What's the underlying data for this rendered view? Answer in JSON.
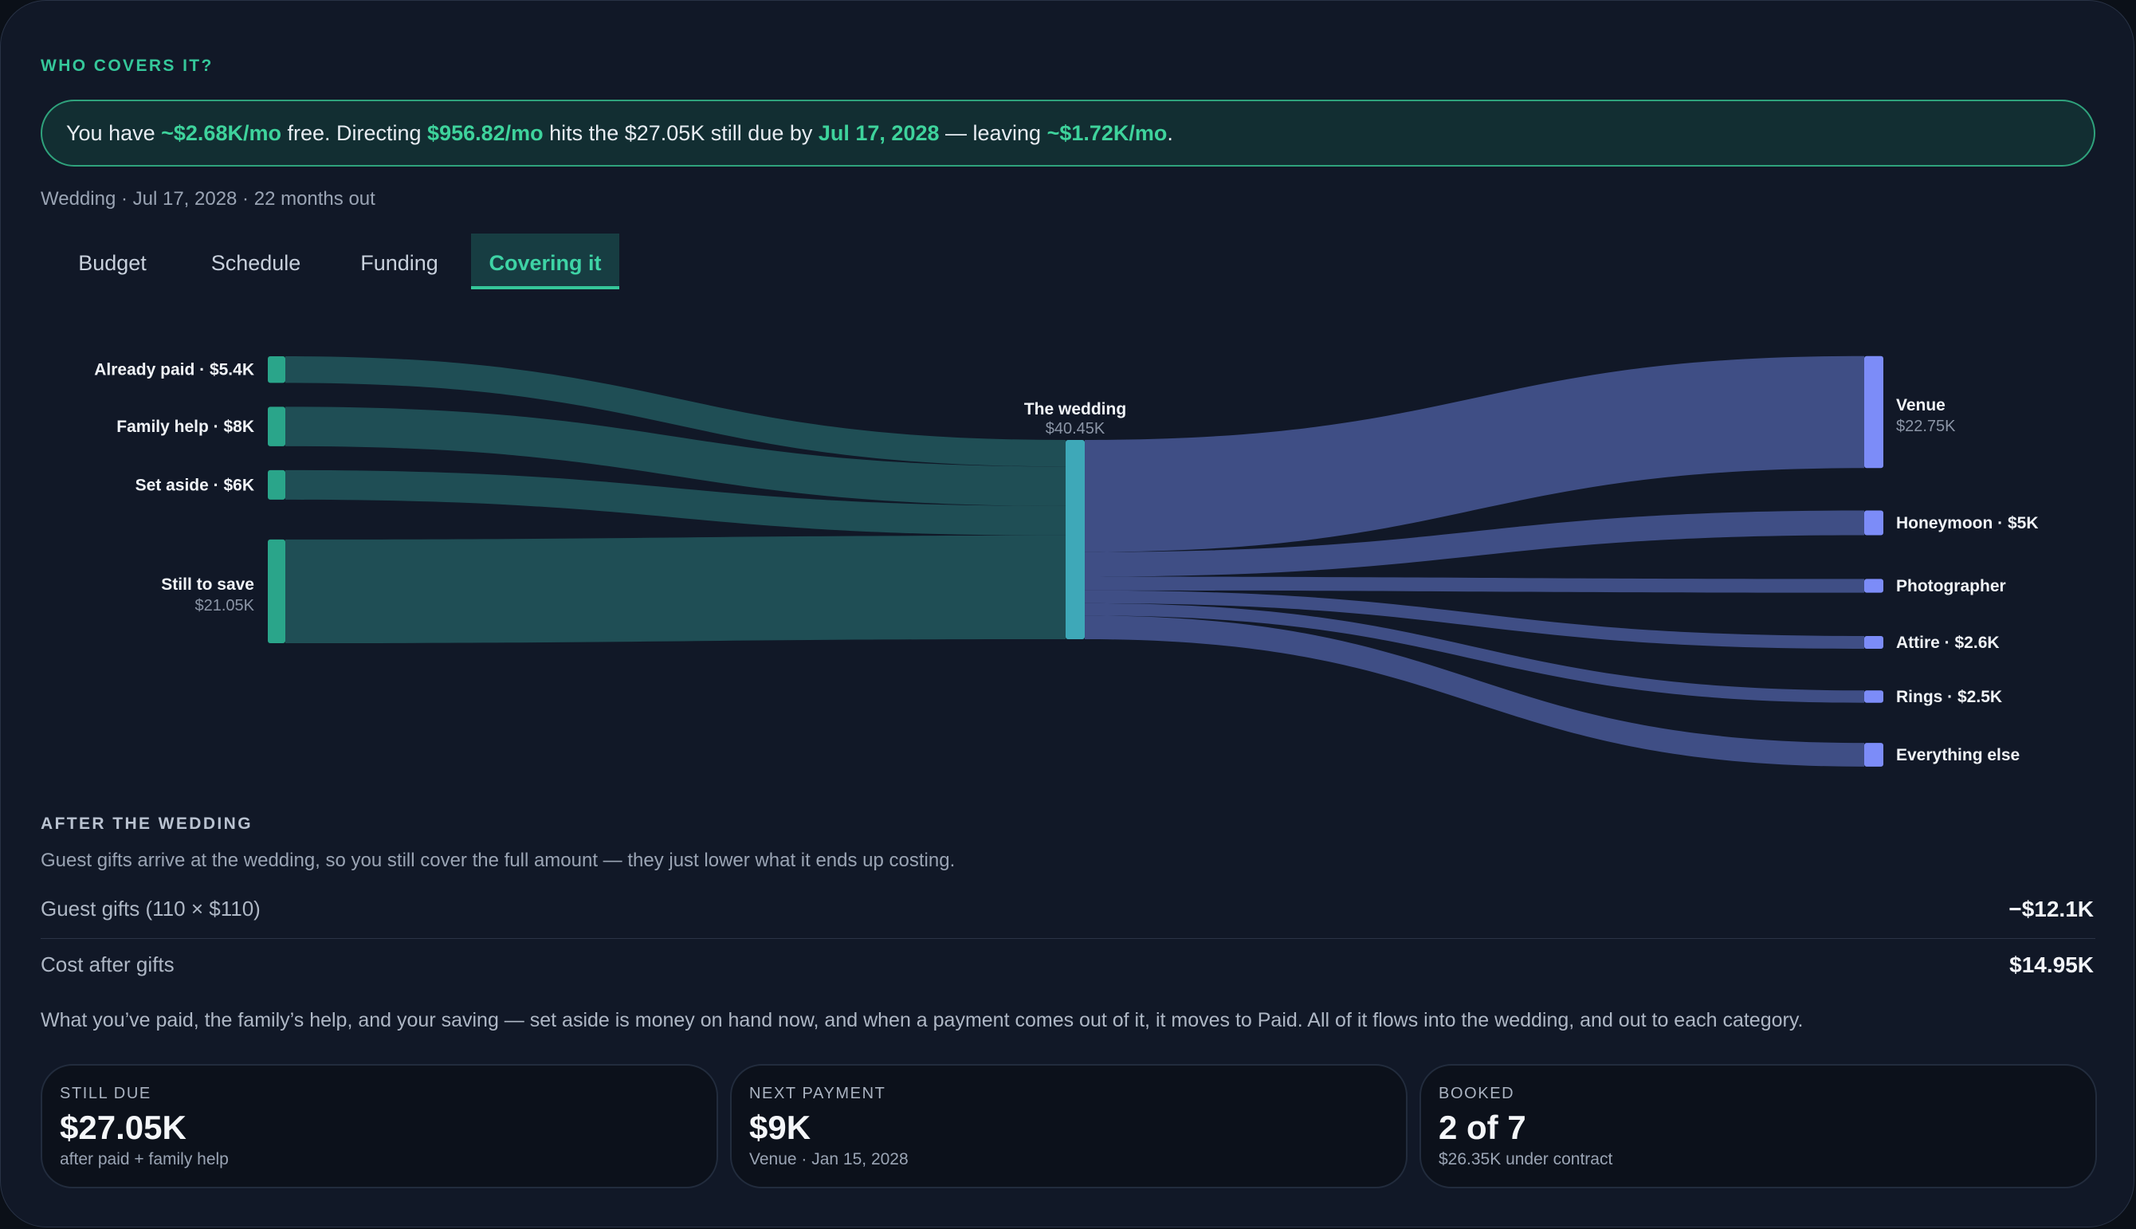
{
  "header": {
    "label": "WHO COVERS IT?"
  },
  "banner": {
    "p1": "You have ",
    "free": "~$2.68K/mo",
    "p2": " free. Directing ",
    "directing": "$956.82/mo",
    "p3": " hits the $27.05K still due by ",
    "date": "Jul 17, 2028",
    "p4": " — leaving ",
    "leaving": "~$1.72K/mo",
    "p5": "."
  },
  "subline": "Wedding · Jul 17, 2028 · 22 months out",
  "tabs": [
    {
      "label": "Budget",
      "active": false
    },
    {
      "label": "Schedule",
      "active": false
    },
    {
      "label": "Funding",
      "active": false
    },
    {
      "label": "Covering it",
      "active": true
    }
  ],
  "chart_data": {
    "type": "sankey",
    "sources": [
      {
        "label": "Already paid · $5.4K",
        "value": 5.4
      },
      {
        "label": "Family help · $8K",
        "value": 8
      },
      {
        "label": "Set aside · $6K",
        "value": 6
      },
      {
        "label": "Still to save",
        "value_label": "$21.05K",
        "value": 21.05
      }
    ],
    "center": {
      "label": "The wedding",
      "value_label": "$40.45K",
      "value": 40.45
    },
    "targets": [
      {
        "label": "Venue",
        "value_label": "$22.75K",
        "value": 22.75
      },
      {
        "label": "Honeymoon · $5K",
        "value": 5
      },
      {
        "label": "Photographer",
        "value": 2.8
      },
      {
        "label": "Attire · $2.6K",
        "value": 2.6
      },
      {
        "label": "Rings · $2.5K",
        "value": 2.5
      },
      {
        "label": "Everything else",
        "value": 4.8
      }
    ],
    "colors": {
      "source": "#2aa58a",
      "source_flow": "#1f4e55",
      "center": "#3ea8b8",
      "target": "#7c8cf8",
      "target_flow": "#3f4e85"
    }
  },
  "after": {
    "label": "AFTER THE WEDDING",
    "desc": "Guest gifts arrive at the wedding, so you still cover the full amount — they just lower what it ends up costing.",
    "rows": [
      {
        "label": "Guest gifts (110 × $110)",
        "value": "−$12.1K"
      },
      {
        "label": "Cost after gifts",
        "value": "$14.95K"
      }
    ],
    "explain": "What you’ve paid, the family’s help, and your saving — set aside is money on hand now, and when a payment comes out of it, it moves to Paid. All of it flows into the wedding, and out to each category."
  },
  "stats": [
    {
      "title": "STILL DUE",
      "value": "$27.05K",
      "sub": "after paid + family help"
    },
    {
      "title": "NEXT PAYMENT",
      "value": "$9K",
      "sub": "Venue · Jan 15, 2028"
    },
    {
      "title": "BOOKED",
      "value": "2 of 7",
      "sub": "$26.35K under contract"
    }
  ]
}
